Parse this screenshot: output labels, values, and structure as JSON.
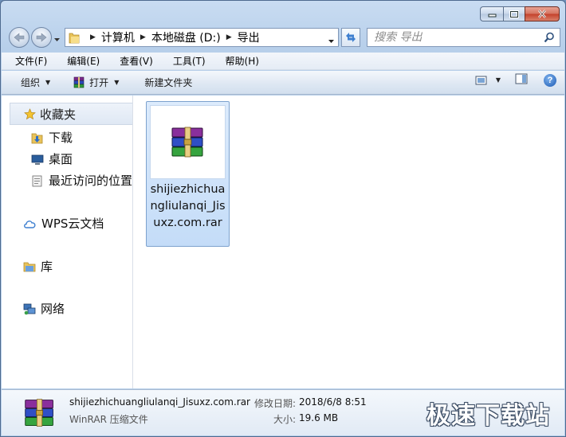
{
  "address": {
    "crumbs": [
      "计算机",
      "本地磁盘 (D:)",
      "导出"
    ]
  },
  "search": {
    "placeholder": "搜索 导出"
  },
  "menu": [
    "文件(F)",
    "编辑(E)",
    "查看(V)",
    "工具(T)",
    "帮助(H)"
  ],
  "toolbar": {
    "organize": "组织",
    "open": "打开",
    "new_folder": "新建文件夹"
  },
  "nav": {
    "favorites": "收藏夹",
    "downloads": "下载",
    "desktop": "桌面",
    "recent": "最近访问的位置",
    "wps": "WPS云文档",
    "libraries": "库",
    "network": "网络"
  },
  "files": [
    {
      "name": "shijiezhichuangliulanqi_Jisuxz.com.rar",
      "selected": true
    }
  ],
  "details": {
    "name": "shijiezhichuangliulanqi_Jisuxz.com.rar",
    "type": "WinRAR 压缩文件",
    "modified_label": "修改日期:",
    "modified_value": "2018/6/8 8:51",
    "size_label": "大小:",
    "size_value": "19.6 MB"
  },
  "watermark": "极速下载站",
  "colors": {
    "selection": "#cce4fb",
    "chrome": "#b7cfea",
    "close": "#c4402a"
  }
}
